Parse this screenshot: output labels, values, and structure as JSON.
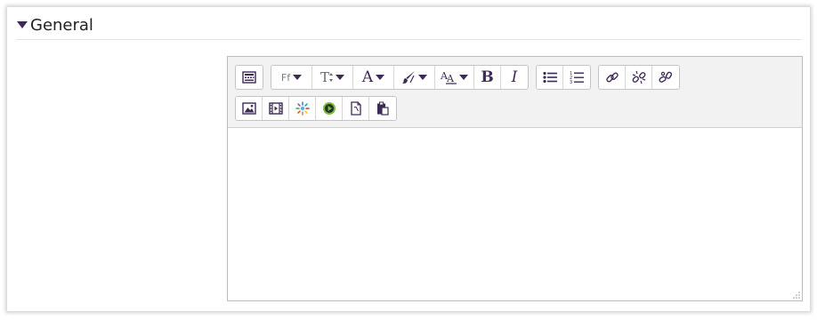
{
  "section": {
    "title": "General",
    "expanded": true
  },
  "editor": {
    "content": "",
    "toolbar": {
      "row1": [
        {
          "group": "toolbar-toggle",
          "buttons": [
            {
              "name": "show-more-buttons",
              "icon": "keyboard-icon"
            }
          ]
        },
        {
          "group": "font",
          "buttons": [
            {
              "name": "font-family",
              "label": "Ff",
              "dropdown": true
            },
            {
              "name": "font-size",
              "label": "T",
              "dropdown": true
            },
            {
              "name": "font-color",
              "label": "A",
              "dropdown": true
            },
            {
              "name": "highlight-color",
              "icon": "brush-icon",
              "dropdown": true
            },
            {
              "name": "styles",
              "label": "A",
              "dropdown": true
            },
            {
              "name": "bold",
              "label": "B"
            },
            {
              "name": "italic",
              "label": "I"
            }
          ]
        },
        {
          "group": "lists",
          "buttons": [
            {
              "name": "unordered-list",
              "icon": "bullet-list-icon"
            },
            {
              "name": "ordered-list",
              "icon": "numbered-list-icon"
            }
          ]
        },
        {
          "group": "links",
          "buttons": [
            {
              "name": "link",
              "icon": "link-icon"
            },
            {
              "name": "unlink",
              "icon": "unlink-icon"
            },
            {
              "name": "auto-link",
              "icon": "auto-link-icon"
            }
          ]
        }
      ],
      "row2": [
        {
          "group": "media",
          "buttons": [
            {
              "name": "insert-image",
              "icon": "image-icon"
            },
            {
              "name": "insert-media",
              "icon": "film-icon"
            },
            {
              "name": "record-media",
              "icon": "sparkle-icon"
            },
            {
              "name": "play-media",
              "icon": "play-icon"
            },
            {
              "name": "manage-files",
              "icon": "document-icon"
            },
            {
              "name": "paste",
              "icon": "clipboard-icon"
            }
          ]
        }
      ]
    }
  },
  "colors": {
    "icon": "#3d2a55",
    "toolbar_bg": "#f2f2f2",
    "border": "#bcbcbc"
  }
}
